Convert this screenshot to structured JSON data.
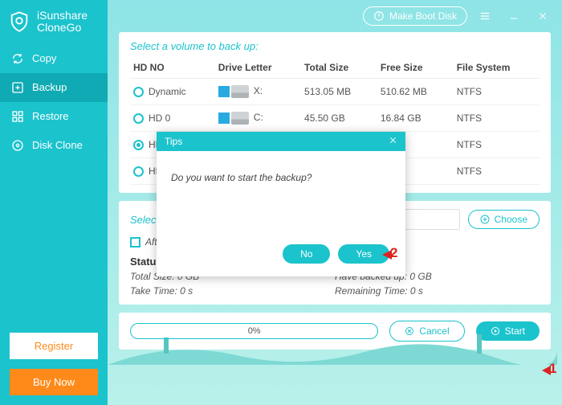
{
  "app": {
    "name_line1": "iSunshare",
    "name_line2": "CloneGo"
  },
  "titlebar": {
    "make_boot": "Make Boot Disk"
  },
  "sidebar": {
    "items": [
      {
        "label": "Copy"
      },
      {
        "label": "Backup"
      },
      {
        "label": "Restore"
      },
      {
        "label": "Disk Clone"
      }
    ],
    "register": "Register",
    "buy_now": "Buy Now"
  },
  "volumes": {
    "title": "Select a volume to back up:",
    "headers": {
      "hdno": "HD NO",
      "drive": "Drive Letter",
      "total": "Total Size",
      "free": "Free Size",
      "fs": "File System"
    },
    "rows": [
      {
        "hdno": "Dynamic",
        "win": true,
        "drive": "X:",
        "total": "513.05 MB",
        "free": "510.62 MB",
        "fs": "NTFS",
        "checked": false
      },
      {
        "hdno": "HD 0",
        "win": true,
        "drive": "C:",
        "total": "45.50 GB",
        "free": "16.84 GB",
        "fs": "NTFS",
        "checked": false
      },
      {
        "hdno": "HD 0",
        "win": false,
        "drive": "",
        "total": "",
        "free": "B",
        "fs": "NTFS",
        "checked": true
      },
      {
        "hdno": "HD 1",
        "win": false,
        "drive": "",
        "total": "",
        "free": "B",
        "fs": "NTFS",
        "checked": false
      }
    ]
  },
  "destination": {
    "title": "Select a",
    "choose": "Choose",
    "after_label": "After"
  },
  "status": {
    "title": "Status:",
    "total": "Total Size: 0 GB",
    "backed": "Have backed up: 0 GB",
    "take": "Take Time: 0 s",
    "remain": "Remaining Time: 0 s"
  },
  "footer": {
    "progress": "0%",
    "cancel": "Cancel",
    "start": "Start"
  },
  "modal": {
    "title": "Tips",
    "body": "Do you want to start the backup?",
    "no": "No",
    "yes": "Yes"
  },
  "callouts": {
    "one": "1",
    "two": "2"
  }
}
